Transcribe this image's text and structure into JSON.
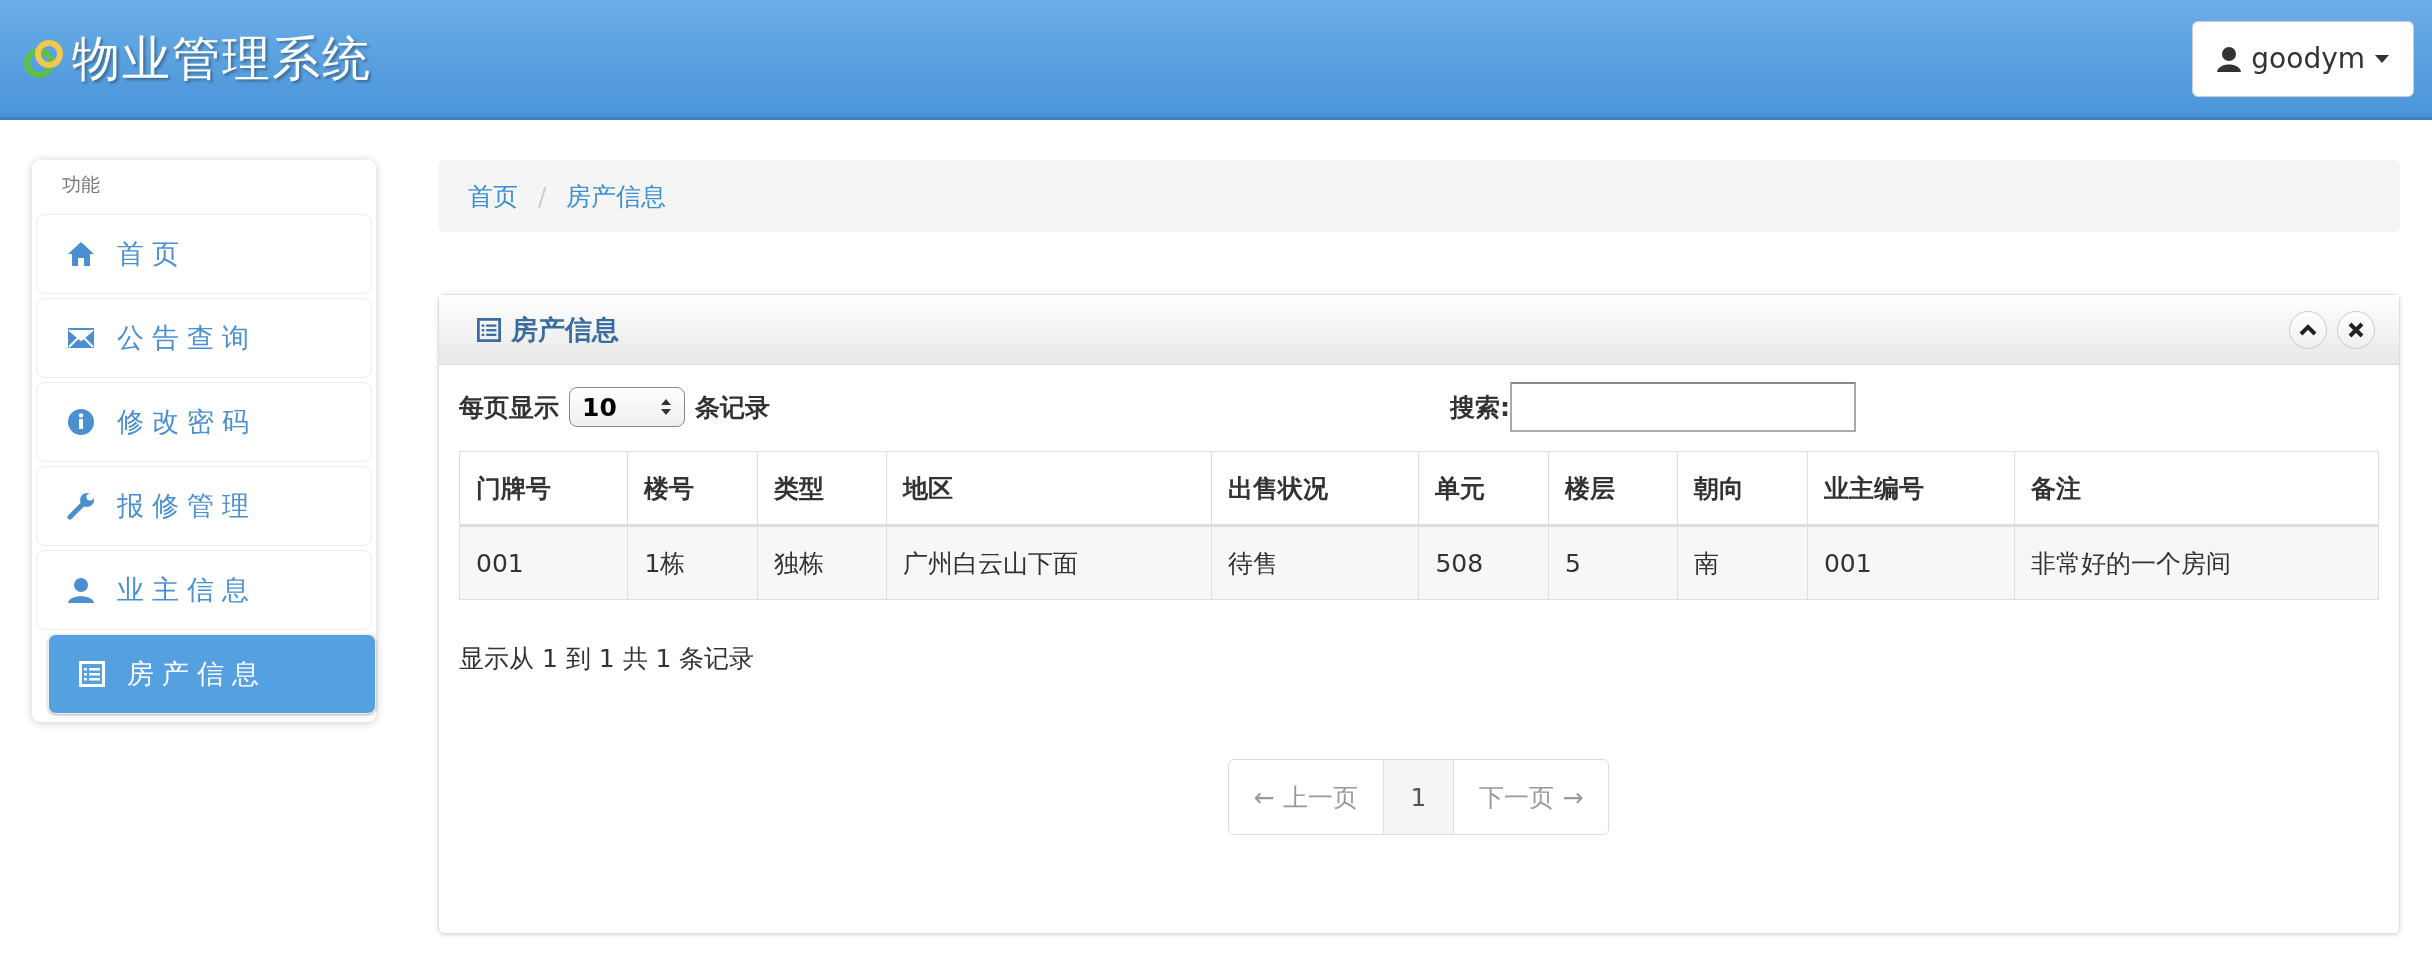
{
  "header": {
    "title": "物业管理系统",
    "user": "goodym"
  },
  "sidebar": {
    "heading": "功能",
    "items": [
      {
        "label": "首页",
        "selected": false
      },
      {
        "label": "公告查询",
        "selected": false
      },
      {
        "label": "修改密码",
        "selected": false
      },
      {
        "label": "报修管理",
        "selected": false
      },
      {
        "label": "业主信息",
        "selected": false
      },
      {
        "label": "房产信息",
        "selected": true
      }
    ]
  },
  "breadcrumb": {
    "separator": "/",
    "items": [
      "首页",
      "房产信息"
    ]
  },
  "panel": {
    "title": "房产信息",
    "page_size": {
      "label_before": "每页显示",
      "value": "10",
      "label_after": "条记录"
    },
    "search": {
      "label": "搜索:"
    },
    "table": {
      "columns": [
        "门牌号",
        "楼号",
        "类型",
        "地区",
        "出售状况",
        "单元",
        "楼层",
        "朝向",
        "业主编号",
        "备注"
      ],
      "rows": [
        [
          "001",
          "1栋",
          "独栋",
          "广州白云山下面",
          "待售",
          "508",
          "5",
          "南",
          "001",
          "非常好的一个房间"
        ]
      ]
    },
    "info": "显示从 1 到 1 共 1 条记录",
    "pagination": [
      {
        "label": "← 上一页",
        "disabled": true,
        "selected": false
      },
      {
        "label": "1",
        "disabled": false,
        "selected": true
      },
      {
        "label": "下一页 →",
        "disabled": true,
        "selected": false
      }
    ]
  }
}
